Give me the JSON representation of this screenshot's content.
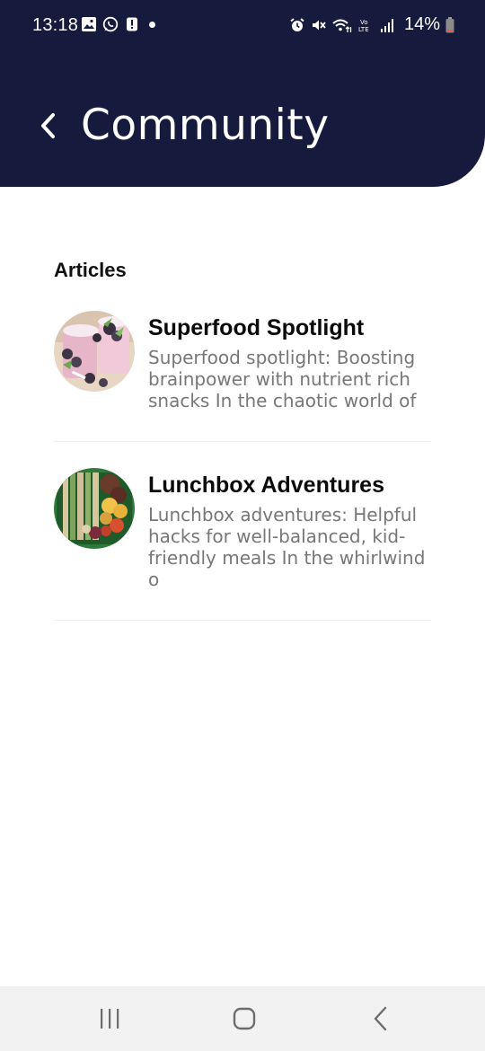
{
  "status_bar": {
    "time": "13:18",
    "battery_percent": "14%",
    "left_icons": [
      "gallery-icon",
      "whatsapp-icon",
      "alert-icon"
    ],
    "right_icons": [
      "alarm-icon",
      "mute-icon",
      "wifi-icon",
      "volte-icon",
      "signal-icon",
      "battery-icon"
    ]
  },
  "header": {
    "title": "Community",
    "background_color": "#161a3c"
  },
  "articles_section": {
    "title": "Articles",
    "items": [
      {
        "title": "Superfood Spotlight",
        "excerpt": "Superfood spotlight: Boosting brainpower with nutrient rich snacks In the chaotic world of",
        "thumbnail": "smoothie-berries-image"
      },
      {
        "title": "Lunchbox Adventures",
        "excerpt": "Lunchbox adventures: Helpful hacks for well-balanced, kid-friendly meals In the whirlwind o",
        "thumbnail": "lunchbox-food-image"
      }
    ]
  },
  "nav_bar": {
    "icons": [
      "recent-apps-icon",
      "home-icon",
      "back-icon"
    ]
  }
}
